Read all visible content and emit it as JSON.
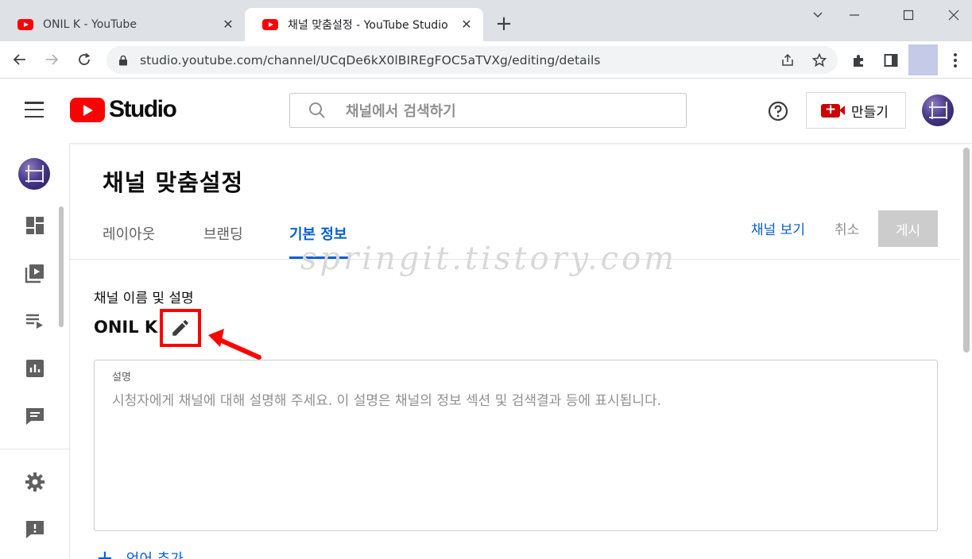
{
  "browser": {
    "tabs": [
      {
        "title": "ONIL K - YouTube",
        "active": false
      },
      {
        "title": "채널 맞춤설정 - YouTube Studio",
        "active": true
      }
    ],
    "url": "studio.youtube.com/channel/UCqDe6kX0lBIREgFOC5aTVXg/editing/details"
  },
  "header": {
    "logo_text": "Studio",
    "search_placeholder": "채널에서 검색하기",
    "create_label": "만들기"
  },
  "rail": {
    "icons": [
      "avatar",
      "dashboard-icon",
      "content-icon",
      "playlists-icon",
      "analytics-icon",
      "comments-icon",
      "settings-icon",
      "feedback-icon"
    ]
  },
  "main": {
    "page_title": "채널 맞춤설정",
    "tabs": [
      {
        "label": "레이아웃"
      },
      {
        "label": "브랜딩"
      },
      {
        "label": "기본 정보",
        "selected": true
      }
    ],
    "view_channel_label": "채널 보기",
    "cancel_label": "취소",
    "publish_label": "게시",
    "watermark": "springit.tistory.com",
    "section_label": "채널 이름 및 설명",
    "channel_name": "ONIL K",
    "description_label": "설명",
    "description_placeholder": "시청자에게 채널에 대해 설명해 주세요. 이 설명은 채널의 정보 섹션 및 검색결과 등에 표시됩니다.",
    "add_language_label": "언어 추가"
  },
  "colors": {
    "accent_blue": "#065fd4",
    "youtube_red": "#ff0000",
    "annotation_red": "#ff0000"
  }
}
